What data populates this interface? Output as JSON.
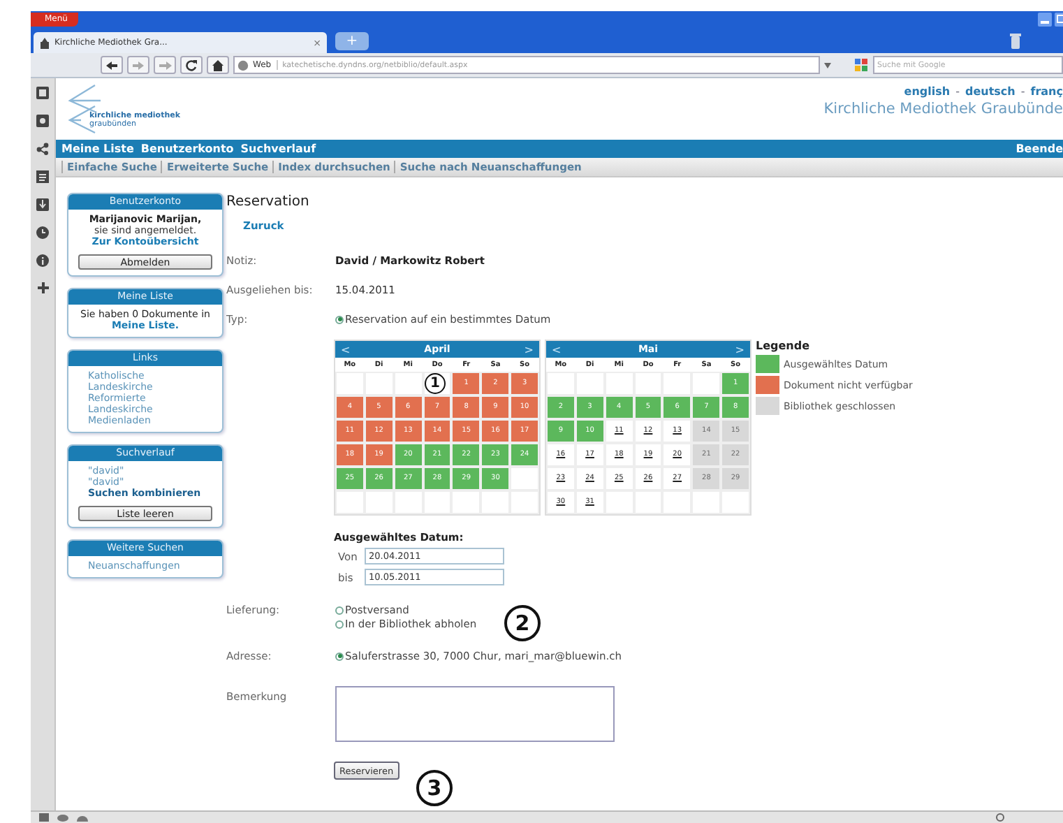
{
  "browser": {
    "menu_button": "Menü",
    "tab": {
      "title": "Kirchliche Mediothek Gra...",
      "close": "×"
    },
    "new_tab": "+",
    "address_badge": "Web",
    "address": "katechetische.dyndns.org/netbiblio/default.aspx",
    "search_placeholder": "Suche mit Google"
  },
  "header": {
    "logo_text": [
      "kirchliche mediothek",
      "graubünden"
    ],
    "languages": [
      {
        "kind": "link",
        "text": "english"
      },
      {
        "kind": "separator",
        "text": "-"
      },
      {
        "kind": "link",
        "text": "deutsch"
      },
      {
        "kind": "separator",
        "text": "-"
      },
      {
        "kind": "link",
        "text": "franç"
      }
    ],
    "site_title": "Kirchliche Mediothek Graubünde"
  },
  "nav": {
    "items": [
      "Meine Liste",
      "Benutzerkonto",
      "Suchverlauf"
    ],
    "right": "Beende"
  },
  "subnav": [
    "Einfache Suche",
    "Erweiterte Suche",
    "Index durchsuchen",
    "Suche nach Neuanschaffungen"
  ],
  "sidebar": [
    {
      "title": "Benutzerkonto",
      "items": [
        {
          "kind": "bold",
          "text": "Marijanovic Marijan,"
        },
        {
          "kind": "text",
          "text": "sie sind angemeldet."
        },
        {
          "kind": "link",
          "text": "Zur Kontoübersicht"
        },
        {
          "kind": "button",
          "text": "Abmelden"
        }
      ]
    },
    {
      "title": "Meine Liste",
      "items": [
        {
          "kind": "paragraph",
          "text": "Sie haben 0 Dokumente in **Meine Liste.**"
        }
      ]
    },
    {
      "title": "Links",
      "items": [
        {
          "kind": "light_link",
          "text": "Katholische"
        },
        {
          "kind": "light_link",
          "text": "Landeskirche"
        },
        {
          "kind": "light_link",
          "text": "Reformierte"
        },
        {
          "kind": "light_link",
          "text": "Landeskirche"
        },
        {
          "kind": "light_link",
          "text": "Medienladen"
        }
      ]
    },
    {
      "title": "Suchverlauf",
      "items": [
        {
          "kind": "light_link",
          "text": "\"david\""
        },
        {
          "kind": "light_link",
          "text": "\"david\""
        },
        {
          "kind": "bold_link",
          "text": "Suchen kombinieren"
        },
        {
          "kind": "button",
          "text": "Liste leeren"
        }
      ]
    },
    {
      "title": "Weitere Suchen",
      "items": [
        {
          "kind": "light_link",
          "text": "Neuanschaffungen"
        }
      ]
    }
  ],
  "reservation": {
    "title": "Reservation",
    "back_link": "Zuruck",
    "notiz": {
      "label": "Notiz:",
      "value": "David / Markowitz Robert"
    },
    "ausgeliehen": {
      "label": "Ausgeliehen bis:",
      "value": "15.04.2011"
    },
    "typ": {
      "label": "Typ:",
      "options": [
        {
          "label": "Reservation auf ein bestimmtes Datum",
          "selected": true
        }
      ]
    },
    "calendars": [
      {
        "month": "April",
        "prev": "<",
        "next": ">",
        "weekdays": [
          "Mo",
          "Di",
          "Mi",
          "Do",
          "Fr",
          "Sa",
          "So"
        ],
        "weeks": [
          [
            {
              "kind": "empty"
            },
            {
              "kind": "empty"
            },
            {
              "kind": "empty"
            },
            {
              "kind": "empty"
            },
            {
              "day": "1",
              "kind": "unavailable"
            },
            {
              "day": "2",
              "kind": "unavailable"
            },
            {
              "day": "3",
              "kind": "unavailable"
            }
          ],
          [
            {
              "day": "4",
              "kind": "unavailable"
            },
            {
              "day": "5",
              "kind": "unavailable"
            },
            {
              "day": "6",
              "kind": "unavailable"
            },
            {
              "day": "7",
              "kind": "unavailable"
            },
            {
              "day": "8",
              "kind": "unavailable"
            },
            {
              "day": "9",
              "kind": "unavailable"
            },
            {
              "day": "10",
              "kind": "unavailable"
            }
          ],
          [
            {
              "day": "11",
              "kind": "unavailable"
            },
            {
              "day": "12",
              "kind": "unavailable"
            },
            {
              "day": "13",
              "kind": "unavailable"
            },
            {
              "day": "14",
              "kind": "unavailable"
            },
            {
              "day": "15",
              "kind": "unavailable"
            },
            {
              "day": "16",
              "kind": "unavailable"
            },
            {
              "day": "17",
              "kind": "unavailable"
            }
          ],
          [
            {
              "day": "18",
              "kind": "unavailable"
            },
            {
              "day": "19",
              "kind": "unavailable"
            },
            {
              "day": "20",
              "kind": "selected"
            },
            {
              "day": "21",
              "kind": "selected"
            },
            {
              "day": "22",
              "kind": "selected"
            },
            {
              "day": "23",
              "kind": "selected"
            },
            {
              "day": "24",
              "kind": "selected"
            }
          ],
          [
            {
              "day": "25",
              "kind": "selected"
            },
            {
              "day": "26",
              "kind": "selected"
            },
            {
              "day": "27",
              "kind": "selected"
            },
            {
              "day": "28",
              "kind": "selected"
            },
            {
              "day": "29",
              "kind": "selected"
            },
            {
              "day": "30",
              "kind": "selected"
            },
            {
              "kind": "empty"
            }
          ],
          [
            {
              "kind": "empty"
            },
            {
              "kind": "empty"
            },
            {
              "kind": "empty"
            },
            {
              "kind": "empty"
            },
            {
              "kind": "empty"
            },
            {
              "kind": "empty"
            },
            {
              "kind": "empty"
            }
          ]
        ]
      },
      {
        "month": "Mai",
        "prev": "<",
        "next": ">",
        "weekdays": [
          "Mo",
          "Di",
          "Mi",
          "Do",
          "Fr",
          "Sa",
          "So"
        ],
        "weeks": [
          [
            {
              "kind": "empty"
            },
            {
              "kind": "empty"
            },
            {
              "kind": "empty"
            },
            {
              "kind": "empty"
            },
            {
              "kind": "empty"
            },
            {
              "kind": "empty"
            },
            {
              "day": "1",
              "kind": "selected"
            }
          ],
          [
            {
              "day": "2",
              "kind": "selected"
            },
            {
              "day": "3",
              "kind": "selected"
            },
            {
              "day": "4",
              "kind": "selected"
            },
            {
              "day": "5",
              "kind": "selected"
            },
            {
              "day": "6",
              "kind": "selected"
            },
            {
              "day": "7",
              "kind": "selected"
            },
            {
              "day": "8",
              "kind": "selected"
            }
          ],
          [
            {
              "day": "9",
              "kind": "selected"
            },
            {
              "day": "10",
              "kind": "selected"
            },
            {
              "day": "11",
              "kind": "available"
            },
            {
              "day": "12",
              "kind": "available"
            },
            {
              "day": "13",
              "kind": "available"
            },
            {
              "day": "14",
              "kind": "closed"
            },
            {
              "day": "15",
              "kind": "closed"
            }
          ],
          [
            {
              "day": "16",
              "kind": "available"
            },
            {
              "day": "17",
              "kind": "available"
            },
            {
              "day": "18",
              "kind": "available"
            },
            {
              "day": "19",
              "kind": "available"
            },
            {
              "day": "20",
              "kind": "available"
            },
            {
              "day": "21",
              "kind": "closed"
            },
            {
              "day": "22",
              "kind": "closed"
            }
          ],
          [
            {
              "day": "23",
              "kind": "available"
            },
            {
              "day": "24",
              "kind": "available"
            },
            {
              "day": "25",
              "kind": "available"
            },
            {
              "day": "26",
              "kind": "available"
            },
            {
              "day": "27",
              "kind": "available"
            },
            {
              "day": "28",
              "kind": "closed"
            },
            {
              "day": "29",
              "kind": "closed"
            }
          ],
          [
            {
              "day": "30",
              "kind": "available"
            },
            {
              "day": "31",
              "kind": "available"
            },
            {
              "kind": "empty"
            },
            {
              "kind": "empty"
            },
            {
              "kind": "empty"
            },
            {
              "kind": "empty"
            },
            {
              "kind": "empty"
            }
          ]
        ]
      }
    ],
    "legend": {
      "title": "Legende",
      "items": [
        {
          "label": "Ausgewähltes Datum",
          "kind": "selected",
          "color": "#5cb85c"
        },
        {
          "label": "Dokument nicht verfügbar",
          "kind": "unavailable",
          "color": "#e2704f"
        },
        {
          "label": "Bibliothek geschlossen",
          "kind": "closed",
          "color": "#d8d8d8"
        }
      ]
    },
    "selected_dates": {
      "title": "Ausgewähltes Datum:",
      "from": {
        "label": "Von",
        "value": "20.04.2011"
      },
      "to": {
        "label": "bis",
        "value": "10.05.2011"
      }
    },
    "delivery": {
      "label": "Lieferung:",
      "options": [
        {
          "label": "Postversand",
          "selected": false
        },
        {
          "label": "In der Bibliothek abholen",
          "selected": false
        }
      ]
    },
    "address": {
      "label": "Adresse:",
      "options": [
        {
          "label": "Saluferstrasse 30, 7000 Chur, mari_mar@bluewin.ch",
          "selected": true
        }
      ]
    },
    "remark": {
      "label": "Bemerkung"
    },
    "submit": "Reservieren",
    "annotations": [
      "1",
      "2",
      "3"
    ]
  }
}
